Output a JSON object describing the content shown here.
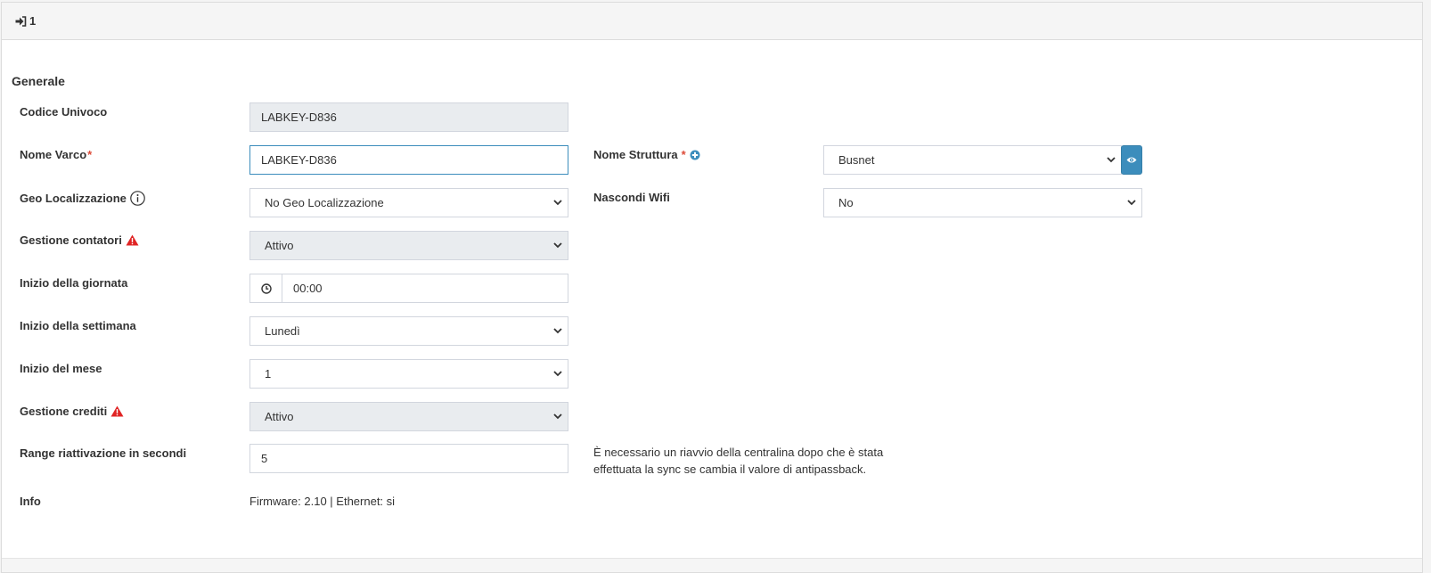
{
  "header": {
    "title": "1",
    "icon": "sign-in-icon"
  },
  "section": {
    "title": "Generale"
  },
  "fields": {
    "codice_univoco": {
      "label": "Codice Univoco",
      "value": "LABKEY-D836"
    },
    "nome_varco": {
      "label": "Nome Varco",
      "required": "*",
      "value": "LABKEY-D836"
    },
    "nome_struttura": {
      "label": "Nome Struttura",
      "required": "*",
      "value": "Busnet"
    },
    "geo_localizzazione": {
      "label": "Geo Localizzazione",
      "value": "No Geo Localizzazione"
    },
    "nascondi_wifi": {
      "label": "Nascondi Wifi",
      "value": "No"
    },
    "gestione_contatori": {
      "label": "Gestione contatori",
      "value": "Attivo"
    },
    "inizio_giornata": {
      "label": "Inizio della giornata",
      "value": "00:00"
    },
    "inizio_settimana": {
      "label": "Inizio della settimana",
      "value": "Lunedì"
    },
    "inizio_mese": {
      "label": "Inizio del mese",
      "value": "1"
    },
    "gestione_crediti": {
      "label": "Gestione crediti",
      "value": "Attivo"
    },
    "range_riattivazione": {
      "label": "Range riattivazione in secondi",
      "value": "5"
    },
    "info": {
      "label": "Info",
      "value": "Firmware: 2.10 | Ethernet: si"
    }
  },
  "notes": {
    "range_line1": "È necessario un riavvio della centralina dopo che è stata",
    "range_line2": "effettuata la sync se cambia il valore di antipassback."
  },
  "colors": {
    "primary": "#3c8dbc",
    "required": "#dd4b39",
    "warning": "#e02424",
    "readonly_bg": "#e9ecef"
  }
}
